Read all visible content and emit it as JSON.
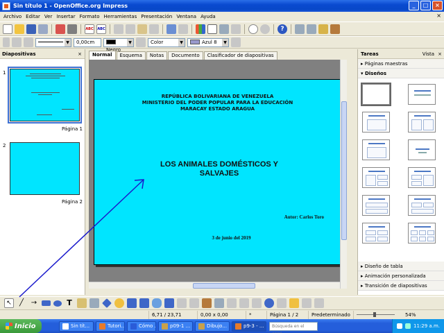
{
  "window": {
    "title": "Sin título 1 - OpenOffice.org Impress"
  },
  "menu": [
    "Archivo",
    "Editar",
    "Ver",
    "Insertar",
    "Formato",
    "Herramientas",
    "Presentación",
    "Ventana",
    "Ayuda"
  ],
  "line_toolbar": {
    "width": "0,00cm",
    "line_color": "Negro",
    "area_type": "Color",
    "area_color": "Azul 8"
  },
  "slides_panel": {
    "title": "Diapositivas",
    "slides": [
      {
        "number": "1",
        "label": "Página 1"
      },
      {
        "number": "2",
        "label": "Página 2"
      }
    ]
  },
  "view_tabs": [
    "Normal",
    "Esquema",
    "Notas",
    "Documento",
    "Clasificador de diapositivas"
  ],
  "slide": {
    "institution_lines": [
      "REPÚBLICA BOLIVARIANA DE VENEZUELA",
      "MINISTERIO DEL PODER POPULAR PARA LA EDUCACIÓN",
      "MARACAY ESTADO ARAGUA"
    ],
    "title_lines": [
      "LOS ANIMALES DOMÉSTICOS Y",
      "SALVAJES"
    ],
    "author": "Autor: Carlos Toro",
    "date": "3 de junio del 2019"
  },
  "tasks_panel": {
    "title": "Tareas",
    "view_label": "Vista",
    "sections_top": [
      "Páginas maestras",
      "Diseños"
    ],
    "sections_bottom": [
      "Diseño de tabla",
      "Animación personalizada",
      "Transición de diapositivas"
    ]
  },
  "status": {
    "position": "6,71 / 23,71",
    "size": "0,00 x 0,00",
    "page": "Página 1 / 2",
    "style": "Predeterminado",
    "zoom": "54%"
  },
  "taskbar": {
    "start": "Inicio",
    "tasks": [
      "Sin tít...",
      "Tutori...",
      "Cómo ...",
      "p09-1 ...",
      "Dibujo...",
      "p9-3 - ..."
    ],
    "search_placeholder": "Búsqueda en el escri",
    "clock": "11:29 a.m."
  },
  "colors": {
    "slide_bg": "#00e5ff",
    "arrow": "#1a1acc"
  },
  "icons": [
    "new-icon",
    "open-icon",
    "save-icon",
    "print-icon",
    "spellcheck-icon",
    "cut-icon",
    "copy-icon",
    "paste-icon",
    "undo-icon",
    "redo-icon",
    "chart-icon",
    "table-icon",
    "help-icon",
    "select-icon",
    "line-icon",
    "arrow-icon",
    "rectangle-icon",
    "ellipse-icon",
    "text-icon"
  ]
}
